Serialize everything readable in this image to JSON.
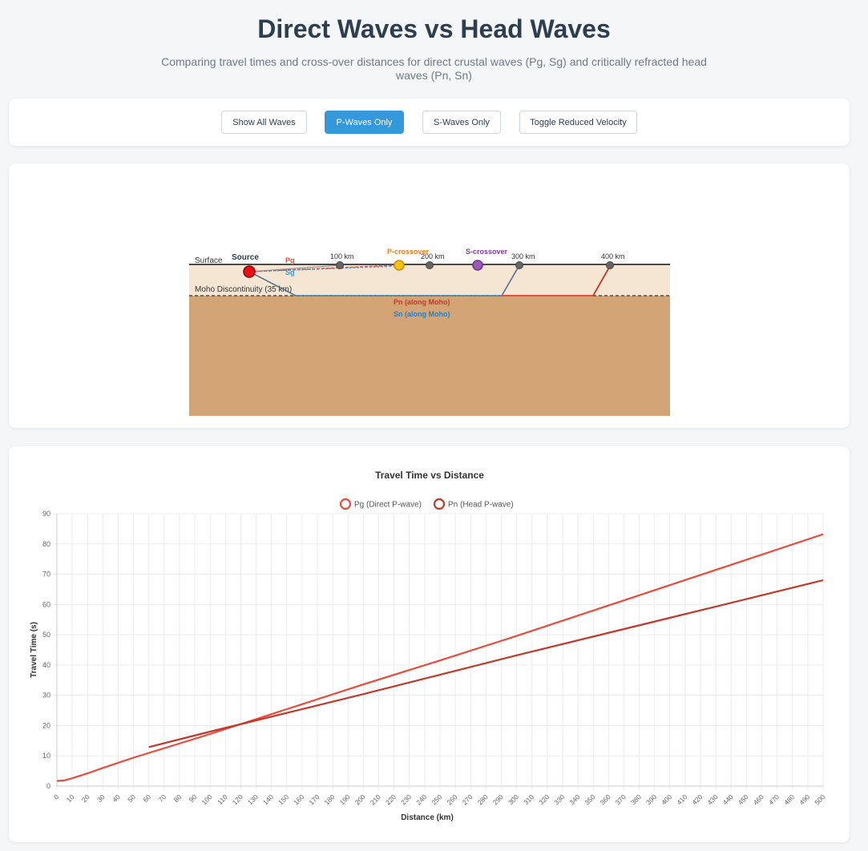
{
  "header": {
    "title": "Direct Waves vs Head Waves",
    "subtitle": "Comparing travel times and cross-over distances for direct crustal waves (Pg, Sg) and critically refracted head waves (Pn, Sn)"
  },
  "controls": {
    "show_all": "Show All Waves",
    "p_only": "P-Waves Only",
    "s_only": "S-Waves Only",
    "reduced": "Toggle Reduced Velocity",
    "active": "p_only"
  },
  "diagram": {
    "surface_label": "Surface",
    "moho_label": "Moho Discontinuity (35 km)",
    "source_label": "Source",
    "pg_label": "Pg",
    "sg_label": "Sg",
    "p_crossover_label": "P-crossover",
    "s_crossover_label": "S-crossover",
    "pn_label": "Pn (along Moho)",
    "sn_label": "Sn (along Moho)",
    "stations": [
      "100 km",
      "200 km",
      "300 km",
      "400 km"
    ],
    "colors": {
      "crust": "#f5e6d3",
      "mantle": "#d4a574",
      "p_wave": "#e74c3c",
      "s_wave": "#3498db",
      "p_crossover": "#f1c40f",
      "s_crossover": "#9b59b6"
    }
  },
  "chart_data": {
    "type": "line",
    "title": "Travel Time vs Distance",
    "xlabel": "Distance (km)",
    "ylabel": "Travel Time (s)",
    "xlim": [
      0,
      500
    ],
    "ylim": [
      0,
      90
    ],
    "x_ticks": [
      0,
      10,
      20,
      30,
      40,
      50,
      60,
      70,
      80,
      90,
      100,
      110,
      120,
      130,
      140,
      150,
      160,
      170,
      180,
      190,
      200,
      210,
      220,
      230,
      240,
      250,
      260,
      270,
      280,
      290,
      300,
      310,
      320,
      330,
      340,
      350,
      360,
      370,
      380,
      390,
      400,
      410,
      420,
      430,
      440,
      450,
      460,
      470,
      480,
      490,
      500
    ],
    "y_ticks": [
      0,
      10,
      20,
      30,
      40,
      50,
      60,
      70,
      80,
      90
    ],
    "grid": true,
    "legend_position": "top",
    "series": [
      {
        "name": "Pg (Direct P-wave)",
        "color": "#e74c3c",
        "x": [
          0,
          5,
          10,
          20,
          30,
          50,
          100,
          150,
          200,
          250,
          300,
          400,
          500
        ],
        "y": [
          1.7,
          1.9,
          2.6,
          4.2,
          6.0,
          9.4,
          17.2,
          25.4,
          33.6,
          41.5,
          49.6,
          66.4,
          83.2
        ]
      },
      {
        "name": "Pn (Head P-wave)",
        "color": "#c0392b",
        "x": [
          60,
          100,
          130,
          200,
          300,
          400,
          500
        ],
        "y": [
          12.9,
          18.0,
          21.7,
          30.4,
          43.2,
          55.6,
          68.0
        ]
      }
    ]
  }
}
